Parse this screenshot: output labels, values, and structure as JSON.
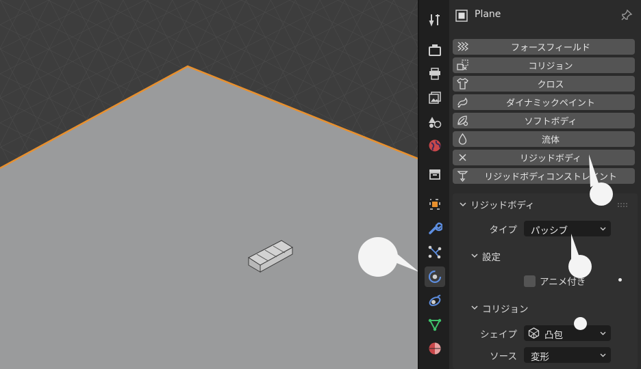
{
  "object_name": "Plane",
  "physics_buttons": [
    {
      "label": "フォースフィールド",
      "icon": "force-field-icon"
    },
    {
      "label": "コリジョン",
      "icon": "collision-icon"
    },
    {
      "label": "クロス",
      "icon": "cloth-icon"
    },
    {
      "label": "ダイナミックペイント",
      "icon": "dynamic-paint-icon"
    },
    {
      "label": "ソフトボディ",
      "icon": "soft-body-icon"
    },
    {
      "label": "流体",
      "icon": "fluid-icon"
    },
    {
      "label": "リジッドボディ",
      "icon": "close-icon"
    },
    {
      "label": "リジッドボディコンストレイント",
      "icon": "rigid-body-constraint-icon"
    }
  ],
  "rigid_body_panel": {
    "title": "リジッドボディ",
    "type_label": "タイプ",
    "type_value": "パッシブ",
    "settings": {
      "title": "設定",
      "animated_label": "アニメ付き",
      "animated_checked": false
    },
    "collision": {
      "title": "コリジョン",
      "shape_label": "シェイプ",
      "shape_value": "凸包",
      "source_label": "ソース",
      "source_value": "変形"
    }
  },
  "tabs": [
    "tool-icon",
    "render-icon",
    "output-icon",
    "view-layer-icon",
    "scene-icon",
    "world-icon",
    "collection-icon",
    "object-icon",
    "modifier-icon",
    "particles-icon",
    "physics-icon",
    "constraints-icon",
    "data-icon",
    "material-icon"
  ],
  "colors": {
    "selection_outline": "#e8902e",
    "plane_surface": "#9a9b9c",
    "grid_background": "#3d3d3d",
    "panel_bg": "#2b2b2b",
    "button_bg": "#545454",
    "active_tab_icon": "#5d8ee0"
  }
}
